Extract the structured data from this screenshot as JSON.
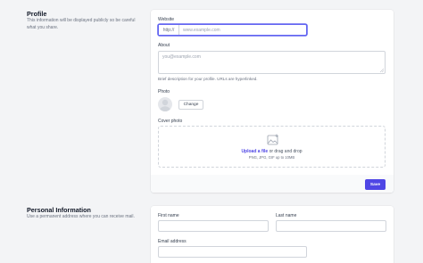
{
  "profile": {
    "title": "Profile",
    "description": "This information will be displayed publicly so be careful what you share.",
    "website": {
      "label": "Website",
      "prefix": "http://",
      "placeholder": "www.example.com"
    },
    "about": {
      "label": "About",
      "placeholder": "you@example.com",
      "help": "Brief description for your profile. URLs are hyperlinked."
    },
    "photo": {
      "label": "Photo",
      "change_label": "Change"
    },
    "cover_photo": {
      "label": "Cover photo",
      "upload_link": "Upload a file",
      "upload_rest": "or drag and drop",
      "hint": "PNG, JPG, GIF up to 10MB"
    },
    "save_label": "Save"
  },
  "personal": {
    "title": "Personal Information",
    "description": "Use a permanent address where you can receive mail.",
    "first_name_label": "First name",
    "last_name_label": "Last name",
    "email_label": "Email address"
  },
  "colors": {
    "accent": "#4f46e5",
    "focus_ring": "#6366f1"
  }
}
